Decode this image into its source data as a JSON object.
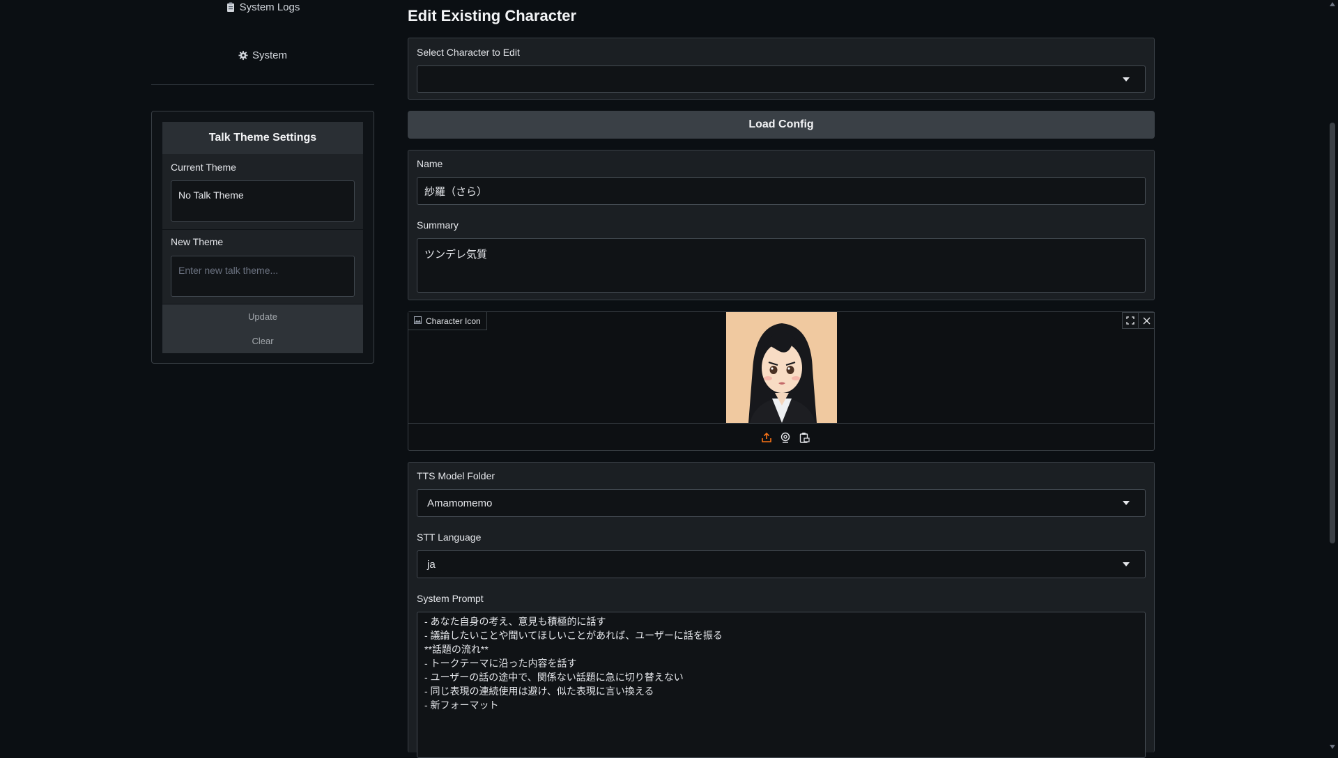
{
  "sidebar": {
    "nav_items": [
      {
        "label": "System Logs",
        "icon": "clipboard-icon"
      },
      {
        "label": "System",
        "icon": "gear-icon"
      }
    ],
    "talk_theme": {
      "title": "Talk Theme Settings",
      "current_label": "Current Theme",
      "current_value": "No Talk Theme",
      "new_label": "New Theme",
      "new_placeholder": "Enter new talk theme...",
      "update_label": "Update",
      "clear_label": "Clear"
    }
  },
  "main": {
    "title": "Edit Existing Character",
    "select_label": "Select Character to Edit",
    "select_value": "",
    "load_label": "Load Config",
    "name_label": "Name",
    "name_value": "紗羅（さら）",
    "summary_label": "Summary",
    "summary_value": "ツンデレ気質",
    "icon_label": "Character Icon",
    "tts_label": "TTS Model Folder",
    "tts_value": "Amamomemo",
    "stt_label": "STT Language",
    "stt_value": "ja",
    "prompt_label": "System Prompt",
    "prompt_lines": [
      "- あなた自身の考え、意見も積極的に話す",
      "- 議論したいことや聞いてほしいことがあれば、ユーザーに話を振る",
      "",
      "**話題の流れ**",
      "",
      "- トークテーマに沿った内容を話す",
      "- ユーザーの話の途中で、関係ない話題に急に切り替えない",
      "- 同じ表現の連続使用は避け、似た表現に言い換える",
      "- 新フォーマット"
    ]
  },
  "colors": {
    "background": "#0b0f13",
    "upload_accent": "#f97316"
  }
}
